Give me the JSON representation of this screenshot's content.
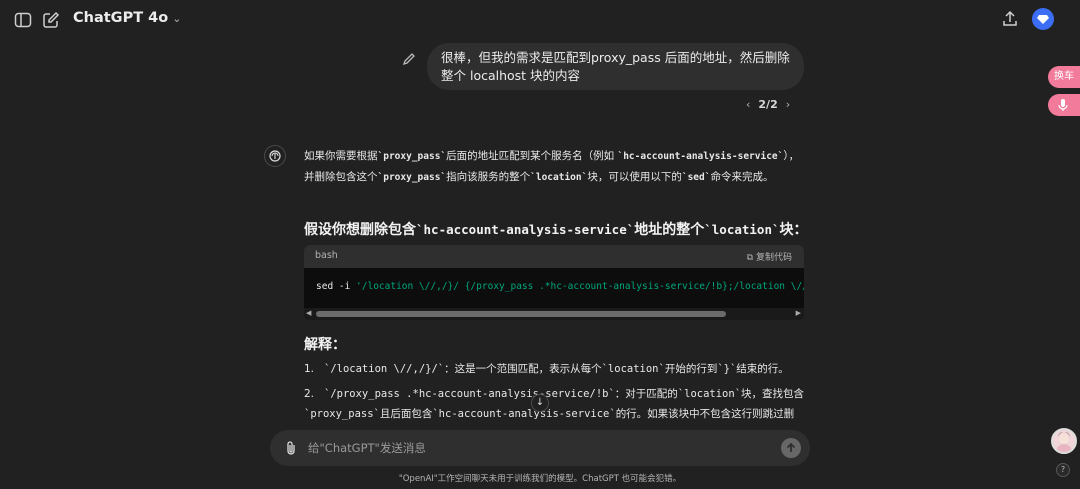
{
  "header": {
    "model_name": "ChatGPT 4o",
    "icons": [
      "sidebar-toggle-icon",
      "new-chat-icon",
      "chevron-down-icon",
      "upload-icon",
      "diamond-icon"
    ]
  },
  "user_message": {
    "text": "很棒，但我的需求是匹配到proxy_pass 后面的地址，然后删除整个 localhost 块的内容",
    "pager": {
      "current": "2/2",
      "prev": "‹",
      "next": "›"
    }
  },
  "assistant": {
    "intro": [
      {
        "t": "如果你需要根据"
      },
      {
        "c": "`proxy_pass`"
      },
      {
        "t": "后面的地址匹配到某个服务名（例如 "
      },
      {
        "c": "`hc-account-analysis-service`"
      },
      {
        "t": "），并删除包含这个"
      },
      {
        "c": "`proxy_pass`"
      },
      {
        "t": "指向该服务的整个"
      },
      {
        "c": "`location`"
      },
      {
        "t": "块，可以使用以下的"
      },
      {
        "c": "`sed`"
      },
      {
        "t": "命令来完成。"
      }
    ],
    "heading1": {
      "pre": "假设你想删除包含",
      "code": "`hc-account-analysis-service`",
      "mid": "地址的整个",
      "code2": "`location`",
      "post": "块："
    },
    "code_block": {
      "lang": "bash",
      "copy_label": "复制代码",
      "cmd": "sed -i ",
      "arg": "'/location \\//,/}/ {/proxy_pass .*hc-account-analysis-service/!b};/location \\//,/}/"
    },
    "heading2": "解释：",
    "list": [
      {
        "num": "1.",
        "parts": [
          {
            "c": "`/location \\//,/}/`"
          },
          {
            "t": "：这是一个范围匹配，表示从每个"
          },
          {
            "c": "`location`"
          },
          {
            "t": "开始的行到"
          },
          {
            "c": "`}`"
          },
          {
            "t": "结束的行。"
          }
        ]
      },
      {
        "num": "2.",
        "parts": [
          {
            "c": "`/proxy_pass .*hc-account-analysis-service/!b`"
          },
          {
            "t": "：对于匹配的"
          },
          {
            "c": "`location`"
          },
          {
            "t": "块，查找包含"
          },
          {
            "c": "`proxy_pass`"
          },
          {
            "t": "且后面包含"
          },
          {
            "c": "`hc-account-analysis-service`"
          },
          {
            "t": "的行。如果该块中不包含这行则跳过删"
          }
        ]
      }
    ]
  },
  "composer": {
    "placeholder": "给\"ChatGPT\"发送消息"
  },
  "footer": "\"OpenAI\"工作空间聊天未用于训练我们的模型。ChatGPT 也可能会犯错。",
  "floating": {
    "swap_label": "换车"
  },
  "help_label": "?",
  "colors": {
    "background": "#212121",
    "bubble": "#2f2f2f",
    "code_string": "#00a67d",
    "float_pink": "#f27a9a",
    "avatar_blue": "#3b6ef5"
  }
}
